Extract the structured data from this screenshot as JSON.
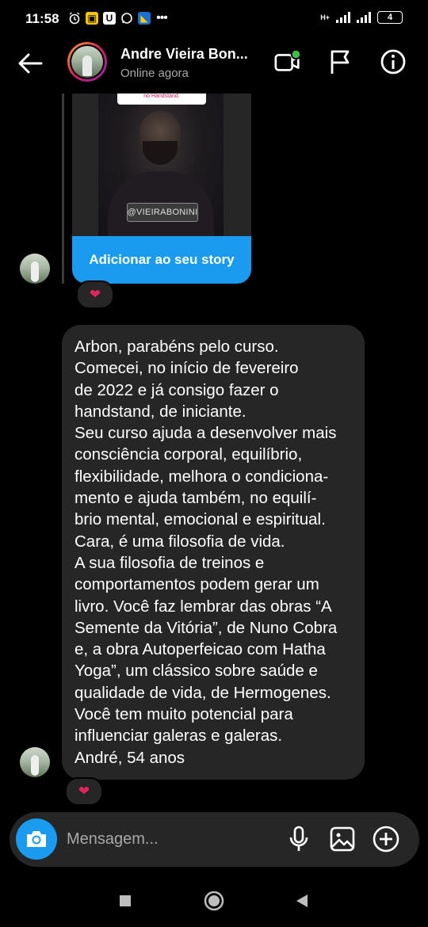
{
  "status": {
    "time": "11:58",
    "battery": "4",
    "net_label": "H+"
  },
  "header": {
    "title": "Andre Vieira Bon...",
    "subtitle": "Online agora"
  },
  "story": {
    "top_label": "no Handstand.",
    "tag": "@VIEIRABONINI",
    "cta_label": "Adicionar ao seu story"
  },
  "message": {
    "text": "Arbon, parabéns pelo curso.\nComecei, no início de fevereiro\nde 2022 e já consigo fazer o\nhandstand, de iniciante.\nSeu curso ajuda a desenvolver mais\nconsciência corporal, equilíbrio,\nflexibilidade, melhora o condiciona-\nmento e ajuda também, no equilí-\nbrio mental, emocional e espiritual.\nCara, é uma filosofia de vida.\nA sua filosofia de treinos e\ncomportamentos podem gerar um\nlivro. Você faz lembrar das obras “A\nSemente da Vitória”, de Nuno Cobra\ne, a obra Autoperfeicao com Hatha\nYoga”, um clássico sobre saúde e\nqualidade de vida, de Hermogenes.\nVocê tem muito potencial para\ninfluenciar galeras e galeras.\nAndré, 54 anos"
  },
  "reactions": {
    "story_reaction": "❤",
    "message_reaction": "❤"
  },
  "composer": {
    "placeholder": "Mensagem..."
  },
  "icons": {
    "back": "arrow-left-icon",
    "video_call": "video-call-icon",
    "flag": "flag-icon",
    "info": "info-icon",
    "camera": "camera-icon",
    "mic": "microphone-icon",
    "gallery": "gallery-icon",
    "add": "plus-circle-icon"
  },
  "colors": {
    "accent_blue": "#1a9bf0",
    "bubble_bg": "#262626",
    "online_green": "#38c24a",
    "heart_red": "#e0245e"
  }
}
